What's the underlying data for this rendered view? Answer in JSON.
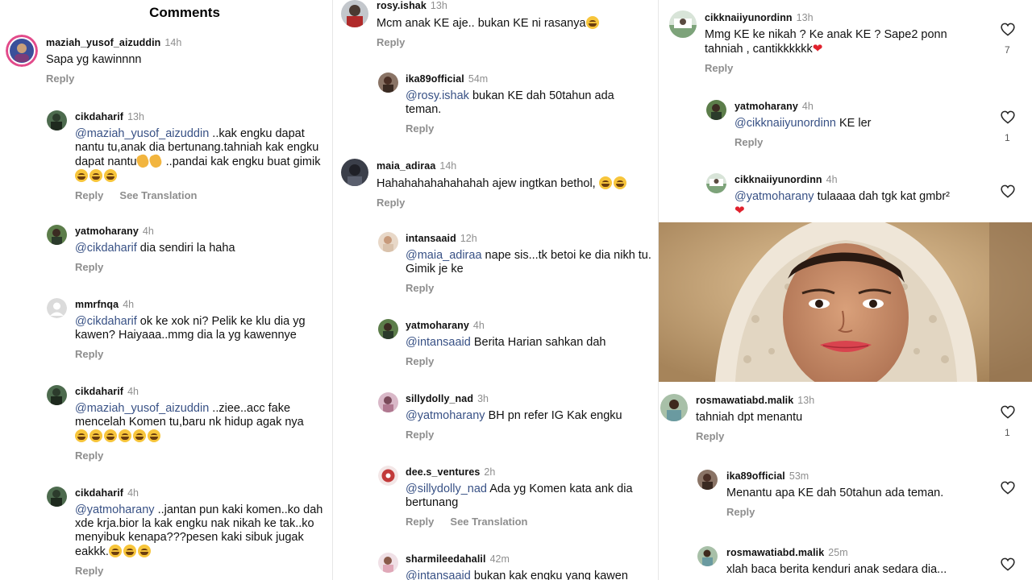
{
  "header": {
    "title": "Comments"
  },
  "labels": {
    "reply": "Reply",
    "see_translation": "See Translation"
  },
  "col1": [
    {
      "user": "maziah_yusof_aizuddin",
      "time": "14h",
      "text": "Sapa yg kawinnnn"
    },
    {
      "user": "cikdaharif",
      "time": "13h",
      "mention": "@maziah_yusof_aizuddin",
      "text": " ..kak engku dapat nantu tu,anak dia bertunang.tahniah kak engku dapat nantu",
      "text2": " ..pandai kak engku buat gimik"
    },
    {
      "user": "yatmoharany",
      "time": "4h",
      "mention": "@cikdaharif",
      "text": " dia sendiri la haha"
    },
    {
      "user": "mmrfnqa",
      "time": "4h",
      "mention": "@cikdaharif",
      "text": " ok ke xok ni? Pelik ke klu dia yg kawen? Haiyaaa..mmg dia la yg kawennye"
    },
    {
      "user": "cikdaharif",
      "time": "4h",
      "mention": "@maziah_yusof_aizuddin",
      "text": " ..ziee..acc fake mencelah Komen tu,baru nk hidup agak nya"
    },
    {
      "user": "cikdaharif",
      "time": "4h",
      "mention": "@yatmoharany",
      "text": " ..jantan pun kaki komen..ko dah xde krja.bior la kak engku nak nikah ke tak..ko menyibuk kenapa???pesen kaki sibuk jugak eakkk."
    }
  ],
  "col2": [
    {
      "user": "rosy.ishak",
      "time": "13h",
      "text": "Mcm anak KE aje.. bukan KE ni rasanya"
    },
    {
      "user": "ika89official",
      "time": "54m",
      "mention": "@rosy.ishak",
      "text": " bukan KE dah 50tahun ada teman."
    },
    {
      "user": "maia_adiraa",
      "time": "14h",
      "text": "Hahahahahahahahah ajew ingtkan bethol, "
    },
    {
      "user": "intansaaid",
      "time": "12h",
      "mention": "@maia_adiraa",
      "text": " nape sis...tk betoi ke dia nikh tu. Gimik je ke"
    },
    {
      "user": "yatmoharany",
      "time": "4h",
      "mention": "@intansaaid",
      "text": " Berita Harian sahkan dah"
    },
    {
      "user": "sillydolly_nad",
      "time": "3h",
      "mention": "@yatmoharany",
      "text": " BH pn refer IG Kak engku"
    },
    {
      "user": "dee.s_ventures",
      "time": "2h",
      "mention": "@sillydolly_nad",
      "text": " Ada yg Komen kata ank dia bertunang"
    },
    {
      "user": "sharmileedahalil",
      "time": "42m",
      "mention": "@intansaaid",
      "text": "  bukan kak engku yang kawen"
    }
  ],
  "col3": [
    {
      "user": "cikknaiiyunordinn",
      "time": "13h",
      "text": "Mmg KE ke nikah ? Ke anak KE ? Sape2 ponn tahniah , cantikkkkkk",
      "likes": "7"
    },
    {
      "user": "yatmoharany",
      "time": "4h",
      "mention": "@cikknaiiyunordinn",
      "text": " KE ler",
      "likes": "1"
    },
    {
      "user": "cikknaiiyunordinn",
      "time": "4h",
      "mention": "@yatmoharany",
      "text": " tulaaaa dah tgk kat gmbr²"
    },
    {
      "user": "rosmawatiabd.malik",
      "time": "13h",
      "text": "tahniah dpt menantu",
      "likes": "1"
    },
    {
      "user": "ika89official",
      "time": "53m",
      "text": "Menantu apa KE dah 50tahun ada teman."
    },
    {
      "user": "rosmawatiabd.malik",
      "time": "25m",
      "text": "xlah baca berita kenduri anak sedara dia..."
    }
  ]
}
